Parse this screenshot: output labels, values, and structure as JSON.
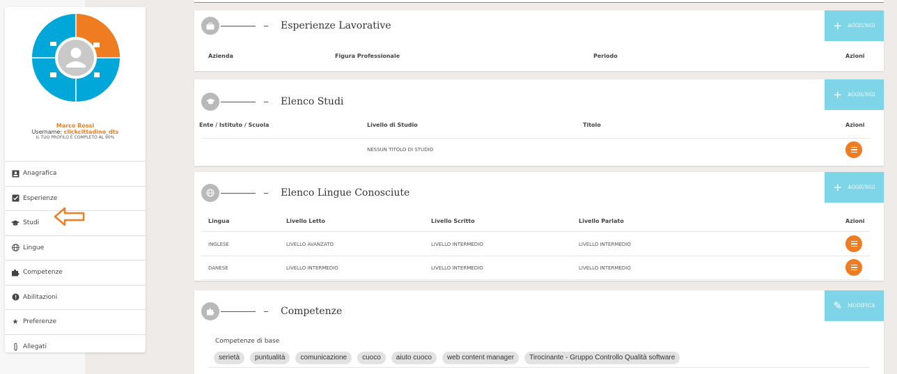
{
  "colors": {
    "accent_orange": "#f07c22",
    "aggiungi_blue": "#7fd5e8",
    "wheel_blue": "#00a7d8",
    "icon_grey": "#b9b9b9"
  },
  "profile": {
    "name": "Marco Rossi",
    "username_label": "Username:",
    "username": "clickcittadino_dts",
    "completion": "IL TUO PROFILO È COMPLETO AL 90%"
  },
  "sidebar": {
    "items": [
      {
        "label": "Anagrafica",
        "icon": "id-card-icon"
      },
      {
        "label": "Esperienze",
        "icon": "check-square-icon"
      },
      {
        "label": "Studi",
        "icon": "graduation-cap-icon"
      },
      {
        "label": "Lingue",
        "icon": "globe-icon"
      },
      {
        "label": "Competenze",
        "icon": "puzzle-icon"
      },
      {
        "label": "Abilitazioni",
        "icon": "certificate-icon"
      },
      {
        "label": "Preferenze",
        "icon": "star-icon"
      },
      {
        "label": "Allegati",
        "icon": "paperclip-icon"
      }
    ]
  },
  "esperienze": {
    "title": "Esperienze Lavorative",
    "add_label": "AGGIUNGI",
    "columns": [
      "Azienda",
      "Figura Professionale",
      "Periodo",
      "Azioni"
    ]
  },
  "studi": {
    "title": "Elenco Studi",
    "add_label": "AGGIUNGI",
    "columns": [
      "Ente / Istituto / Scuola",
      "Livello di Studio",
      "Titolo",
      "Azioni"
    ],
    "empty_text": "NESSUN TITOLO DI STUDIO"
  },
  "lingue": {
    "title": "Elenco Lingue Conosciute",
    "add_label": "AGGIUNGI",
    "columns": [
      "Lingua",
      "Livello Letto",
      "Livello Scritto",
      "Livello Parlato",
      "Azioni"
    ],
    "rows": [
      [
        "INGLESE",
        "LIVELLO AVANZATO",
        "LIVELLO INTERMEDIO",
        "LIVELLO INTERMEDIO"
      ],
      [
        "DANESE",
        "LIVELLO INTERMEDIO",
        "LIVELLO INTERMEDIO",
        "LIVELLO INTERMEDIO"
      ]
    ]
  },
  "competenze": {
    "title": "Competenze",
    "edit_label": "MODIFICA",
    "base_label": "Competenze di base",
    "chips": [
      "serietà",
      "puntualità",
      "comunicazione",
      "cuoco",
      "aiuto cuoco",
      "web content manager",
      "Tirocinante - Gruppo Controllo Qualità software"
    ]
  }
}
